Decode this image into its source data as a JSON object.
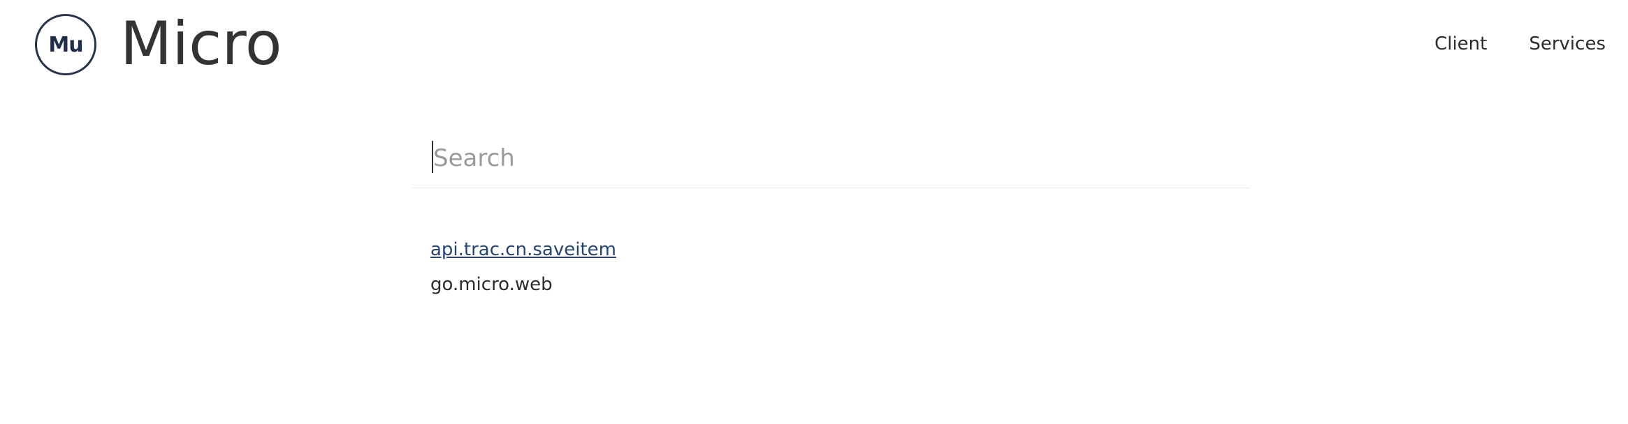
{
  "header": {
    "logo_text": "Mu",
    "brand_title": "Micro",
    "nav": [
      {
        "label": "Client",
        "icon": null
      },
      {
        "label": "Services",
        "icon": null
      }
    ]
  },
  "search": {
    "value": "",
    "placeholder": "Search"
  },
  "results": [
    {
      "label": "api.trac.cn.saveitem",
      "link": true
    },
    {
      "label": "go.micro.web",
      "link": false
    }
  ],
  "colors": {
    "logo": "#24344d",
    "text": "#333333",
    "link": "#24446f",
    "divider": "#e8e8e8"
  }
}
